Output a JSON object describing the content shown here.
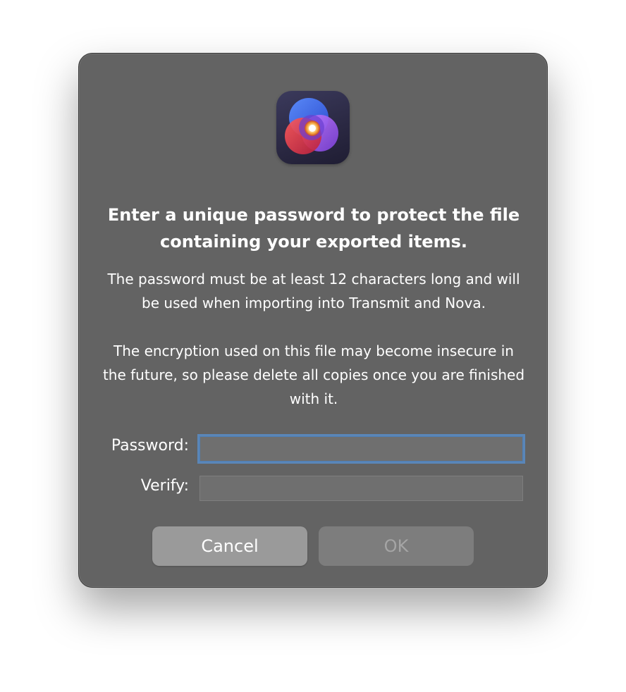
{
  "dialog": {
    "headline": "Enter a unique password to protect the file containing your exported items.",
    "body_1": "The password must be at least 12 characters long and will be used when importing into Transmit and Nova.",
    "body_2": "The encryption used on this file may become insecure in the future, so please delete all copies once you are finished with it.",
    "app_icon": "transmit-nova-app-icon",
    "fields": {
      "password_label": "Password:",
      "password_value": "",
      "verify_label": "Verify:",
      "verify_value": ""
    },
    "buttons": {
      "cancel_label": "Cancel",
      "ok_label": "OK"
    }
  },
  "colors": {
    "dialog_background": "#636363",
    "focus_ring": "#5a86b8",
    "text": "#ffffff",
    "disabled_text": "#a5a5a5"
  }
}
